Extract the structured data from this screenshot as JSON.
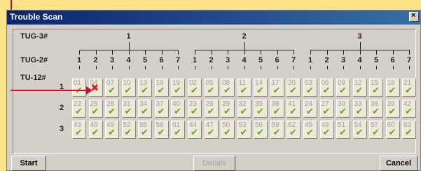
{
  "window": {
    "title": "Trouble Scan",
    "close_label": "×"
  },
  "labels": {
    "tug3": "TUG-3#",
    "tug2": "TUG-2#",
    "tu12": "TU-12#"
  },
  "tug3_numbers": [
    "1",
    "2",
    "3"
  ],
  "tug2_numbers": [
    "1",
    "2",
    "3",
    "4",
    "5",
    "6",
    "7"
  ],
  "row_numbers": [
    "1",
    "2",
    "3"
  ],
  "rows": [
    [
      "01",
      "04",
      "07",
      "10",
      "13",
      "16",
      "19",
      "02",
      "05",
      "08",
      "11",
      "14",
      "17",
      "20",
      "03",
      "06",
      "09",
      "12",
      "15",
      "18",
      "21"
    ],
    [
      "22",
      "25",
      "28",
      "31",
      "34",
      "37",
      "40",
      "23",
      "26",
      "29",
      "32",
      "35",
      "38",
      "41",
      "24",
      "27",
      "30",
      "33",
      "36",
      "39",
      "42"
    ],
    [
      "43",
      "46",
      "49",
      "52",
      "55",
      "58",
      "61",
      "44",
      "47",
      "50",
      "53",
      "56",
      "59",
      "62",
      "45",
      "48",
      "51",
      "54",
      "57",
      "60",
      "63"
    ]
  ],
  "error_cell": "04",
  "buttons": {
    "start": "Start",
    "details": "Details",
    "cancel": "Cancel"
  },
  "colors": {
    "ok": "#6ca326",
    "error": "#d8232a",
    "pointer": "#c8102e"
  }
}
